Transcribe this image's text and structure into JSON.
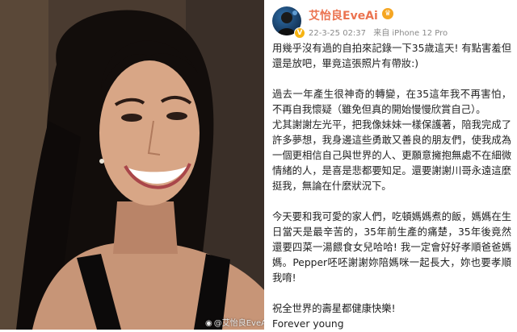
{
  "photo": {
    "alt": "selfie",
    "watermark": "@艾怡良EveAi"
  },
  "post": {
    "author": "艾怡良EveAi",
    "time": "22-3-25 02:37",
    "source": "来自 iPhone 12 Pro",
    "paragraphs": [
      "用幾乎沒有過的自拍來記錄一下35歲這天! 有點害羞但還是放吧，畢竟這張照片有帶妝:)",
      "過去一年產生很神奇的轉變，在35這年我不再害怕，不再自我懷疑（雖免但真的開始慢慢欣賞自己）。",
      "尤其謝謝左光平，把我像妹妹一樣保護著，陪我完成了許多夢想，我身邊這些勇敢又善良的朋友們，使我成為一個更相信自己與世界的人、更願意擁抱無處不在細微情緒的人，是喜是悲都要知足。還要謝謝川哥永遠這麼挺我，無論在什麼狀況下。",
      "今天要和我可愛的家人們，吃頓媽媽煮的飯，媽媽在生日當天是最辛苦的，35年前生產的痛楚，35年後竟然還要四菜一湯餵食女兒哈哈! 我一定會好好孝順爸爸媽媽。Pepper呸呸謝謝妳陪媽咪一起長大，妳也要孝順我唷!",
      "祝全世界的壽星都健康快樂!",
      "Forever young"
    ]
  },
  "colors": {
    "name": "#eb7350",
    "meta": "#8a8a8a",
    "text": "#222222"
  },
  "icons": [
    "verified-badge-icon",
    "vip-crown-icon",
    "weibo-logo-icon"
  ]
}
